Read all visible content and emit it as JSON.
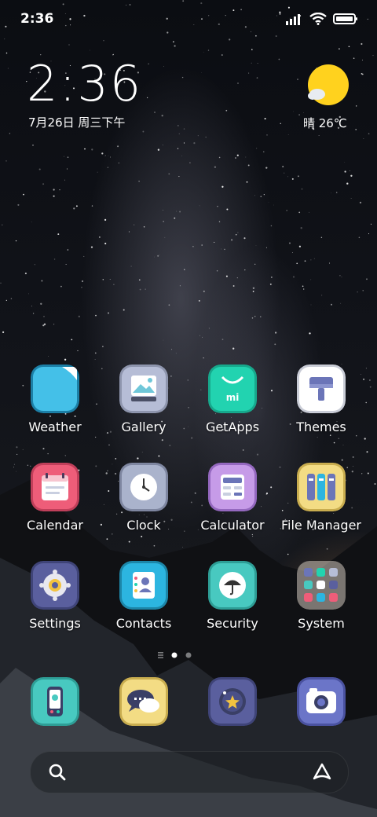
{
  "status_bar": {
    "time": "2:36"
  },
  "clock_widget": {
    "time": "2:36",
    "date": "7月26日 周三下午"
  },
  "weather_widget": {
    "text": "晴 26℃"
  },
  "apps": [
    {
      "label": "Weather"
    },
    {
      "label": "Gallery"
    },
    {
      "label": "GetApps"
    },
    {
      "label": "Themes"
    },
    {
      "label": "Calendar"
    },
    {
      "label": "Clock"
    },
    {
      "label": "Calculator"
    },
    {
      "label": "File Manager"
    },
    {
      "label": "Settings"
    },
    {
      "label": "Contacts"
    },
    {
      "label": "Security"
    },
    {
      "label": "System"
    }
  ],
  "getapps_logo_text": "mi",
  "pager": {
    "pages": 2,
    "current": 1
  },
  "colors": {
    "weather": "#44c0e8",
    "gallery": "#b6bdd6",
    "getapps": "#22d3b0",
    "themes": "#ffffff",
    "calendar": "#ee5d79",
    "clock": "#aab3cc",
    "calculator": "#c69be8",
    "file_manager": "#f3dc84",
    "settings": "#5a5f9e",
    "contacts": "#2cb5e0",
    "security": "#48c9c0",
    "sun": "#ffd21e"
  }
}
